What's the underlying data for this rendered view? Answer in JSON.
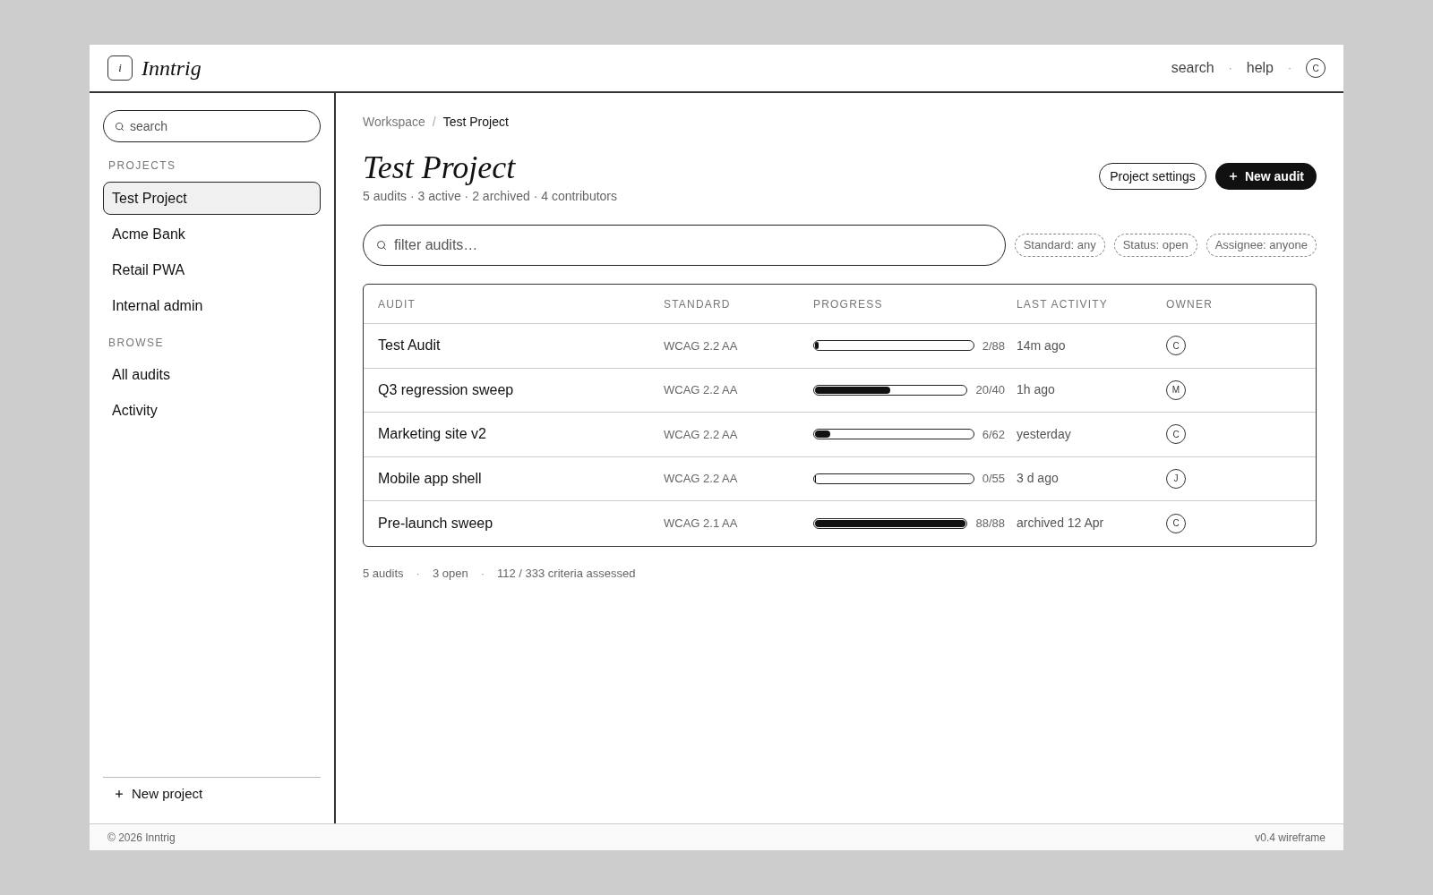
{
  "header": {
    "logo_mark": "i",
    "brand": "Inntrig",
    "nav": [
      {
        "kind": "link",
        "label": "search"
      },
      {
        "kind": "separator",
        "label": "·"
      },
      {
        "kind": "link",
        "label": "help"
      },
      {
        "kind": "separator",
        "label": "·"
      },
      {
        "kind": "avatar",
        "label": "C"
      }
    ]
  },
  "sidebar": {
    "search": {
      "placeholder": "search"
    },
    "sections": [
      {
        "title": "PROJECTS",
        "items": [
          {
            "label": "Test Project",
            "selected": true
          },
          {
            "label": "Acme Bank",
            "selected": false
          },
          {
            "label": "Retail PWA",
            "selected": false
          },
          {
            "label": "Internal admin",
            "selected": false
          }
        ]
      },
      {
        "title": "BROWSE",
        "items": [
          {
            "label": "All audits",
            "selected": false
          },
          {
            "label": "Activity",
            "selected": false
          }
        ]
      }
    ],
    "new_project": "New project"
  },
  "breadcrumb": {
    "separator": "/",
    "items": [
      {
        "label": "Workspace",
        "current": false
      },
      {
        "label": "Test Project",
        "current": true
      }
    ]
  },
  "page": {
    "title": "Test Project",
    "subtitle": "5 audits · 3 active · 2 archived · 4 contributors",
    "buttons": [
      {
        "kind": "secondary",
        "label": "Project settings"
      },
      {
        "kind": "primary",
        "label": "New audit"
      }
    ]
  },
  "filter": {
    "placeholder": "filter audits…",
    "chips": [
      "Standard: any",
      "Status: open",
      "Assignee: anyone"
    ]
  },
  "table": {
    "columns": [
      "AUDIT",
      "STANDARD",
      "PROGRESS",
      "LAST ACTIVITY",
      "OWNER"
    ],
    "rows": [
      {
        "name": "Test Audit",
        "standard": "WCAG 2.2 AA",
        "level": 0.023,
        "reading": "2/88",
        "last_activity": "14m ago",
        "owner": "C"
      },
      {
        "name": "Q3 regression sweep",
        "standard": "WCAG 2.2 AA",
        "level": 0.5,
        "reading": "20/40",
        "last_activity": "1h ago",
        "owner": "M"
      },
      {
        "name": "Marketing site v2",
        "standard": "WCAG 2.2 AA",
        "level": 0.097,
        "reading": "6/62",
        "last_activity": "yesterday",
        "owner": "C"
      },
      {
        "name": "Mobile app shell",
        "standard": "WCAG 2.2 AA",
        "level": 0,
        "reading": "0/55",
        "last_activity": "3 d ago",
        "owner": "J"
      },
      {
        "name": "Pre-launch sweep",
        "standard": "WCAG 2.1 AA",
        "level": 1,
        "reading": "88/88",
        "last_activity": "archived 12 Apr",
        "owner": "C"
      }
    ]
  },
  "summary": [
    {
      "kind": "text",
      "label": "5 audits"
    },
    {
      "kind": "separator",
      "label": "·"
    },
    {
      "kind": "text",
      "label": "3 open"
    },
    {
      "kind": "separator",
      "label": "·"
    },
    {
      "kind": "text",
      "label": "112 / 333 criteria assessed"
    }
  ],
  "footer": {
    "copyright": "© 2026 Inntrig",
    "version": "v0.4 wireframe"
  }
}
